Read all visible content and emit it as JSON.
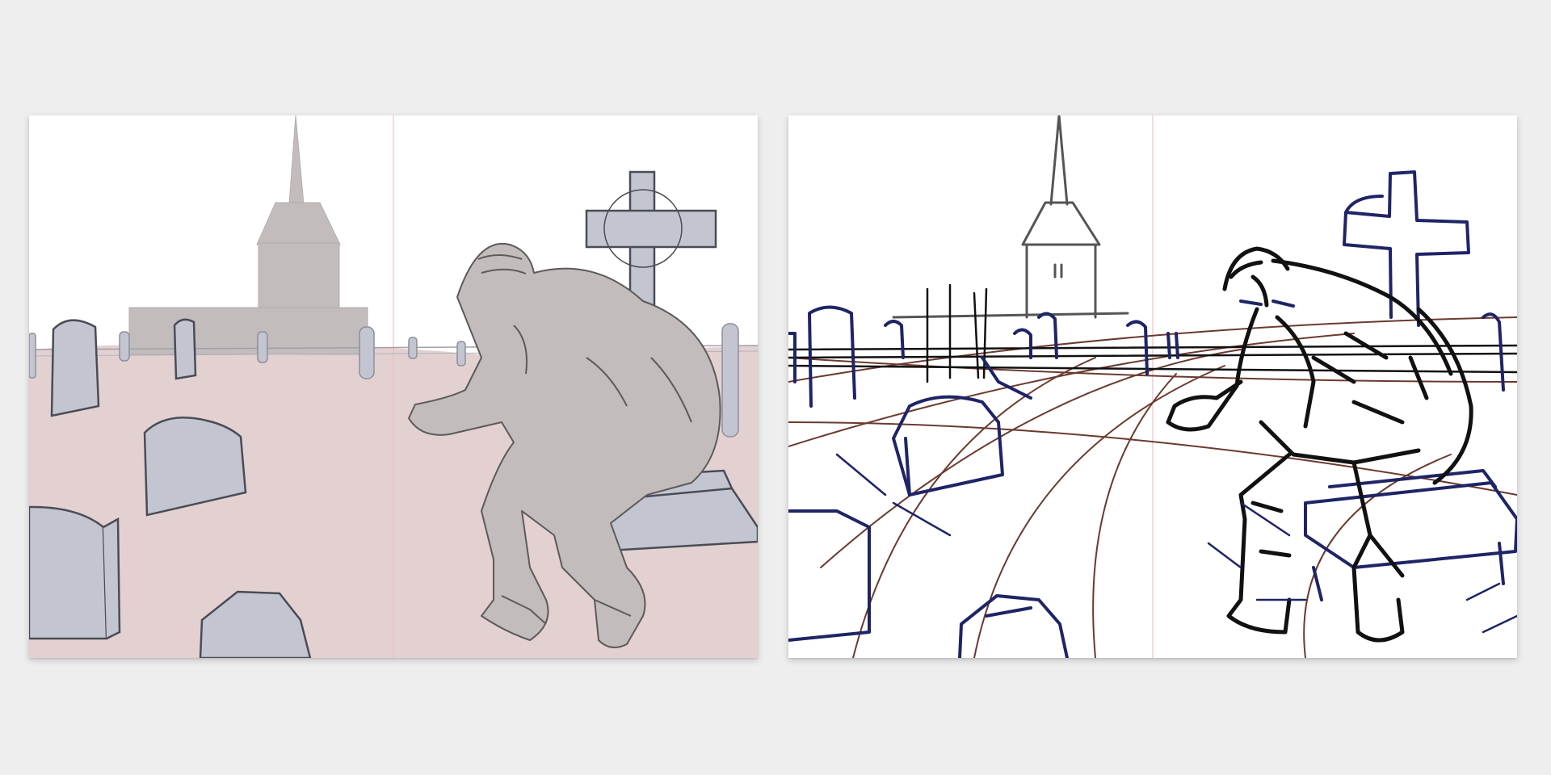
{
  "colors": {
    "page_background": "#eeeeef",
    "ground_fill": "#e3d1d1",
    "silhouette_fill": "#c2bcbc",
    "stone_fill": "#c3c6d0",
    "sketch_line": "#44464c",
    "ink_black": "#111111",
    "ink_blue": "#1e2466",
    "ink_brown": "#6b3a2e",
    "center_guide": "#e9b7b7"
  },
  "panels": [
    {
      "name": "colored-rough-panel",
      "description_icons": [
        "church-icon",
        "cross-icon",
        "gravestone-icon",
        "crouching-figure-icon"
      ]
    },
    {
      "name": "ink-line-panel",
      "description_icons": [
        "church-icon",
        "cross-icon",
        "gravestone-icon",
        "crouching-figure-icon",
        "perspective-guides-icon"
      ]
    }
  ]
}
